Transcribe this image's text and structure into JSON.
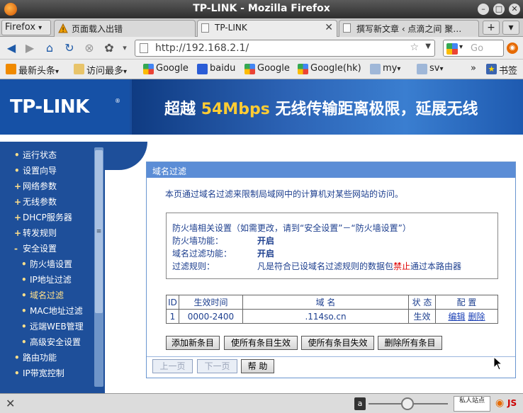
{
  "window": {
    "title": "TP-LINK - Mozilla Firefox"
  },
  "tabbar": {
    "menu_label": "Firefox",
    "tabs": [
      {
        "label": "页面载入出错",
        "icon": "warning-icon",
        "active": false
      },
      {
        "label": "TP-LINK",
        "icon": "page-icon",
        "active": true
      },
      {
        "label": "撰写新文章 ‹ 点滴之间 聚…",
        "icon": "page-icon",
        "active": false
      }
    ],
    "new_tab": "+"
  },
  "navbar": {
    "url": "http://192.168.2.1/",
    "search_placeholder": "Go",
    "search_engine_icon": "google-icon"
  },
  "bookmarks": [
    {
      "label": "最新头条",
      "icon": "rss-icon"
    },
    {
      "label": "访问最多",
      "icon": "folder-icon"
    },
    {
      "label": "Google",
      "icon": "google-icon"
    },
    {
      "label": "baidu",
      "icon": "baidu-icon"
    },
    {
      "label": "Google",
      "icon": "google-icon"
    },
    {
      "label": "Google(hk)",
      "icon": "google-icon"
    },
    {
      "label": "my",
      "icon": "folder-icon"
    },
    {
      "label": "sv",
      "icon": "folder-icon"
    }
  ],
  "bookmarks_overflow": "»",
  "bookmarks_menu": "书签",
  "banner": {
    "logo": "TP-LINK",
    "slogan_pre": "超越",
    "slogan_highlight": "54Mbps",
    "slogan_post": "无线传输距离极限，延展无线"
  },
  "sidebar": {
    "items": [
      {
        "label": "运行状态",
        "bullet": "•",
        "sub": false,
        "current": false
      },
      {
        "label": "设置向导",
        "bullet": "•",
        "sub": false,
        "current": false
      },
      {
        "label": "网络参数",
        "bullet": "+",
        "sub": false,
        "current": false
      },
      {
        "label": "无线参数",
        "bullet": "+",
        "sub": false,
        "current": false
      },
      {
        "label": "DHCP服务器",
        "bullet": "+",
        "sub": false,
        "current": false
      },
      {
        "label": "转发规则",
        "bullet": "+",
        "sub": false,
        "current": false
      },
      {
        "label": "安全设置",
        "bullet": "-",
        "sub": false,
        "current": false
      },
      {
        "label": "防火墙设置",
        "bullet": "•",
        "sub": true,
        "current": false
      },
      {
        "label": "IP地址过滤",
        "bullet": "•",
        "sub": true,
        "current": false
      },
      {
        "label": "域名过滤",
        "bullet": "•",
        "sub": true,
        "current": true
      },
      {
        "label": "MAC地址过滤",
        "bullet": "•",
        "sub": true,
        "current": false
      },
      {
        "label": "远端WEB管理",
        "bullet": "•",
        "sub": true,
        "current": false
      },
      {
        "label": "高级安全设置",
        "bullet": "•",
        "sub": true,
        "current": false
      },
      {
        "label": "路由功能",
        "bullet": "•",
        "sub": false,
        "current": false
      },
      {
        "label": "IP带宽控制",
        "bullet": "•",
        "sub": false,
        "current": false
      }
    ],
    "scroll_grip": "≡"
  },
  "panel": {
    "title": "域名过滤",
    "description": "本页通过域名过滤来限制局域网中的计算机对某些网站的访问。",
    "firewall": {
      "heading": "防火墙相关设置（如需更改，请到“安全设置”－“防火墙设置”）",
      "fw_label": "防火墙功能：",
      "fw_value": "开启",
      "df_label": "域名过滤功能：",
      "df_value": "开启",
      "rule_label": "过滤规则：",
      "rule_pre": "凡是符合已设域名过滤规则的数据包",
      "rule_red": "禁止",
      "rule_post": "通过本路由器"
    },
    "table": {
      "headers": [
        "ID",
        "生效时间",
        "域 名",
        "状 态",
        "配 置"
      ],
      "rows": [
        {
          "id": "1",
          "time": "0000-2400",
          "domain": ".114so.cn",
          "status": "生效",
          "edit": "编辑",
          "delete": "删除"
        }
      ]
    },
    "buttons": {
      "add": "添加新条目",
      "enable_all": "使所有条目生效",
      "disable_all": "使所有条目失效",
      "delete_all": "删除所有条目",
      "prev": "上一页",
      "next": "下一页",
      "help": "帮 助"
    }
  },
  "statusbar": {
    "close": "✕",
    "private_label": "私人站点",
    "js_label": "JS",
    "zoom_icon": "a"
  }
}
